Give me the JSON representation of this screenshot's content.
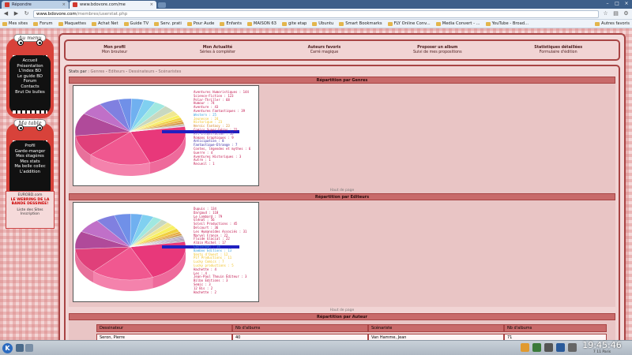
{
  "browser": {
    "tabs": [
      {
        "label": "Répondre",
        "favicon_color": "#d03a30"
      },
      {
        "label": "www.bdovore.com/me",
        "favicon_color": "#d03a30"
      }
    ],
    "url_host": "www.bdovore.com",
    "url_path": "/membres/userstat.php",
    "bookmarks": [
      "Mes sites",
      "Forum",
      "Maquettes",
      "Achat Net",
      "Guide TV",
      "Serv. prati",
      "Pour Aude",
      "Enfants",
      "MAISON 63",
      "gite etap",
      "Ubuntu",
      "Smart Bookmarks",
      "FLY Online Conv...",
      "Media Convert - ...",
      "YouTube - Broad..."
    ],
    "other_bookmarks": "Autres favoris"
  },
  "sidebar": {
    "menu1_title": "Au menu",
    "menu1_items": [
      "Accueil",
      "Présentation",
      "L'index BD",
      "Le guide BD",
      "Forum",
      "Contacts",
      "Brut De bulles"
    ],
    "menu2_title": "Ma table",
    "menu2_items": [
      "Profil",
      "Garde-manger",
      "Mes étagères",
      "Mes stats",
      "Ma belle collec",
      "L'addition"
    ],
    "eurobd_link": "EUROBD.com",
    "webring_line1": "LE WEBRING DE LA",
    "webring_line2": "BANDE DESSINÉE!",
    "webring_list": "Liste des Sites",
    "webring_signup": "Inscription"
  },
  "topnav": [
    {
      "title": "Mon profil",
      "sub": "Mon brouteur"
    },
    {
      "title": "Mon Actualité",
      "sub": "Séries à compléter"
    },
    {
      "title": "Auteurs favoris",
      "sub": "Carré magique"
    },
    {
      "title": "Proposer un album",
      "sub": "Suivi de mes propositions"
    },
    {
      "title": "Statistiques détaillées",
      "sub": "Formulaire d'édition"
    }
  ],
  "stats_bar": {
    "prefix": "Stats par :",
    "links": [
      "Genres",
      "Editeurs",
      "Dessinateurs",
      "Scénaristes"
    ]
  },
  "section_genres": "Répartition par Genres",
  "section_editeurs": "Répartition par Editeurs",
  "section_auteurs": "Répartition par Auteur",
  "haut_de_page": "Haut de page",
  "chart_data": [
    {
      "type": "pie",
      "title": "Répartition par Genres",
      "slices": [
        {
          "label": "Aventures Humoristiques",
          "value": 144,
          "color": "#c0104a"
        },
        {
          "label": "Science-Fiction",
          "value": 123,
          "color": "#c0104a"
        },
        {
          "label": "Polar-Thriller",
          "value": 68,
          "color": "#c0104a"
        },
        {
          "label": "Humour",
          "value": 74,
          "color": "#c0104a"
        },
        {
          "label": "Aventure",
          "value": 43,
          "color": "#c0104a"
        },
        {
          "label": "Aventures Fantastiques",
          "value": 39,
          "color": "#c0104a"
        },
        {
          "label": "Western",
          "value": 25,
          "color": "#3a9fe0"
        },
        {
          "label": "Jeunesse",
          "value": 24,
          "color": "#f0c020"
        },
        {
          "label": "Historique",
          "value": 23,
          "color": "#f0c020"
        },
        {
          "label": "Heroic Fantasy",
          "value": 23,
          "color": "#d08020"
        },
        {
          "label": "Comics Super-héros",
          "value": 22,
          "color": "#c0104a"
        },
        {
          "label": "Art-Illustration",
          "value": 16,
          "color": "#7a3ab0"
        },
        {
          "label": "Romans Graphiques",
          "value": 9,
          "color": "#c0104a"
        },
        {
          "label": "Anticipation",
          "value": 8,
          "color": "#3020a0"
        },
        {
          "label": "Fantastique-Etrange",
          "value": 7,
          "color": "#3020a0"
        },
        {
          "label": "Contes, légendes et mythes",
          "value": 6,
          "color": "#c0104a"
        },
        {
          "label": "Guerre",
          "value": 4,
          "color": "#c0104a"
        },
        {
          "label": "Aventures Historiques",
          "value": 3,
          "color": "#c0104a"
        },
        {
          "label": "Autre",
          "value": 1,
          "color": "#c0104a"
        },
        {
          "label": "Recueil",
          "value": 1,
          "color": "#c0104a"
        }
      ]
    },
    {
      "type": "pie",
      "title": "Répartition par Editeurs",
      "slices": [
        {
          "label": "Dupuis",
          "value": 134,
          "color": "#c0104a"
        },
        {
          "label": "Dargaud",
          "value": 118,
          "color": "#c0104a"
        },
        {
          "label": "Le Lombard",
          "value": 79,
          "color": "#c0104a"
        },
        {
          "label": "Glénat",
          "value": 56,
          "color": "#c0104a"
        },
        {
          "label": "Soleil Productions",
          "value": 45,
          "color": "#c0104a"
        },
        {
          "label": "Delcourt",
          "value": 36,
          "color": "#c0104a"
        },
        {
          "label": "Les Humanoïdes Associés",
          "value": 31,
          "color": "#c0104a"
        },
        {
          "label": "Marvel France",
          "value": 22,
          "color": "#c0104a"
        },
        {
          "label": "Fluide Glacial",
          "value": 22,
          "color": "#c0104a"
        },
        {
          "label": "Albin Michel",
          "value": 17,
          "color": "#c0104a"
        },
        {
          "label": "Casterman",
          "value": 14,
          "color": "#3a9fe0"
        },
        {
          "label": "Bamboo Editions",
          "value": 13,
          "color": "#3a9fe0"
        },
        {
          "label": "Vents d'Ouest",
          "value": 12,
          "color": "#f0c020"
        },
        {
          "label": "Pif Productions",
          "value": 11,
          "color": "#f0c020"
        },
        {
          "label": "Lucky Comics",
          "value": 7,
          "color": "#f0c020"
        },
        {
          "label": "Lucky productions",
          "value": 5,
          "color": "#f0c020"
        },
        {
          "label": "Hachette",
          "value": 4,
          "color": "#c0104a"
        },
        {
          "label": "Les",
          "value": 4,
          "color": "#c0104a"
        },
        {
          "label": "Jean-Paul Thouin Éditeur",
          "value": 3,
          "color": "#c0104a"
        },
        {
          "label": "Bilbo Editions",
          "value": 3,
          "color": "#c0104a"
        },
        {
          "label": "Semic",
          "value": 3,
          "color": "#c0104a"
        },
        {
          "label": "12 Bis",
          "value": 2,
          "color": "#c0104a"
        },
        {
          "label": "Hachette",
          "value": 2,
          "color": "#c0104a"
        }
      ]
    }
  ],
  "authors_table": {
    "headers": [
      "Dessinateur",
      "Nb d'albums",
      "Scénariste",
      "Nb d'albums"
    ],
    "rows": [
      [
        "Seron, Pierre",
        "40",
        "Van Hamme, Jean",
        "71"
      ]
    ]
  },
  "taskbar": {
    "time": "19:45:46",
    "date": "7 11 Paris"
  },
  "colors": {
    "accent": "#a84444",
    "section_header": "#c86a6a",
    "page_bg": "#f4d6d6"
  }
}
